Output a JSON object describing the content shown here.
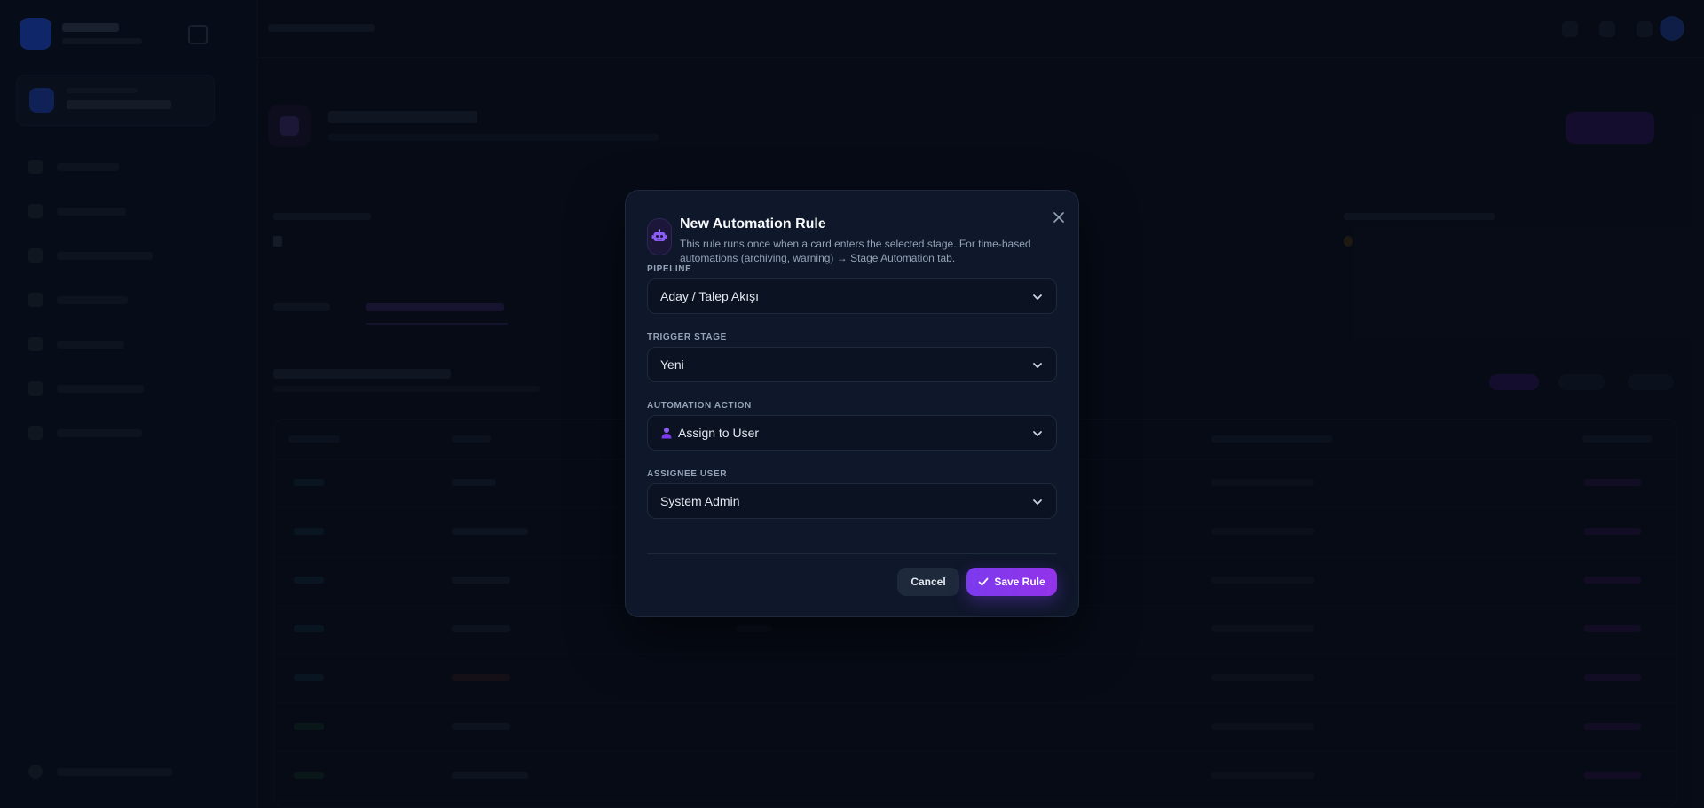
{
  "modal": {
    "title": "New Automation Rule",
    "subtitle": "This rule runs once when a card enters the selected stage. For time-based automations (archiving, warning) → Stage Automation tab.",
    "fields": {
      "pipeline": {
        "label": "PIPELINE",
        "value": "Aday / Talep Akışı"
      },
      "trigger_stage": {
        "label": "TRIGGER STAGE",
        "value": "Yeni"
      },
      "automation_action": {
        "label": "AUTOMATION ACTION",
        "value": "Assign to User",
        "icon": "user-icon"
      },
      "assignee_user": {
        "label": "ASSIGNEE USER",
        "value": "System Admin"
      }
    },
    "buttons": {
      "cancel": "Cancel",
      "save": "Save Rule"
    }
  },
  "colors": {
    "accent": "#7c3aed",
    "modal_bg": "#0f172a",
    "page_bg": "#0b1120"
  }
}
